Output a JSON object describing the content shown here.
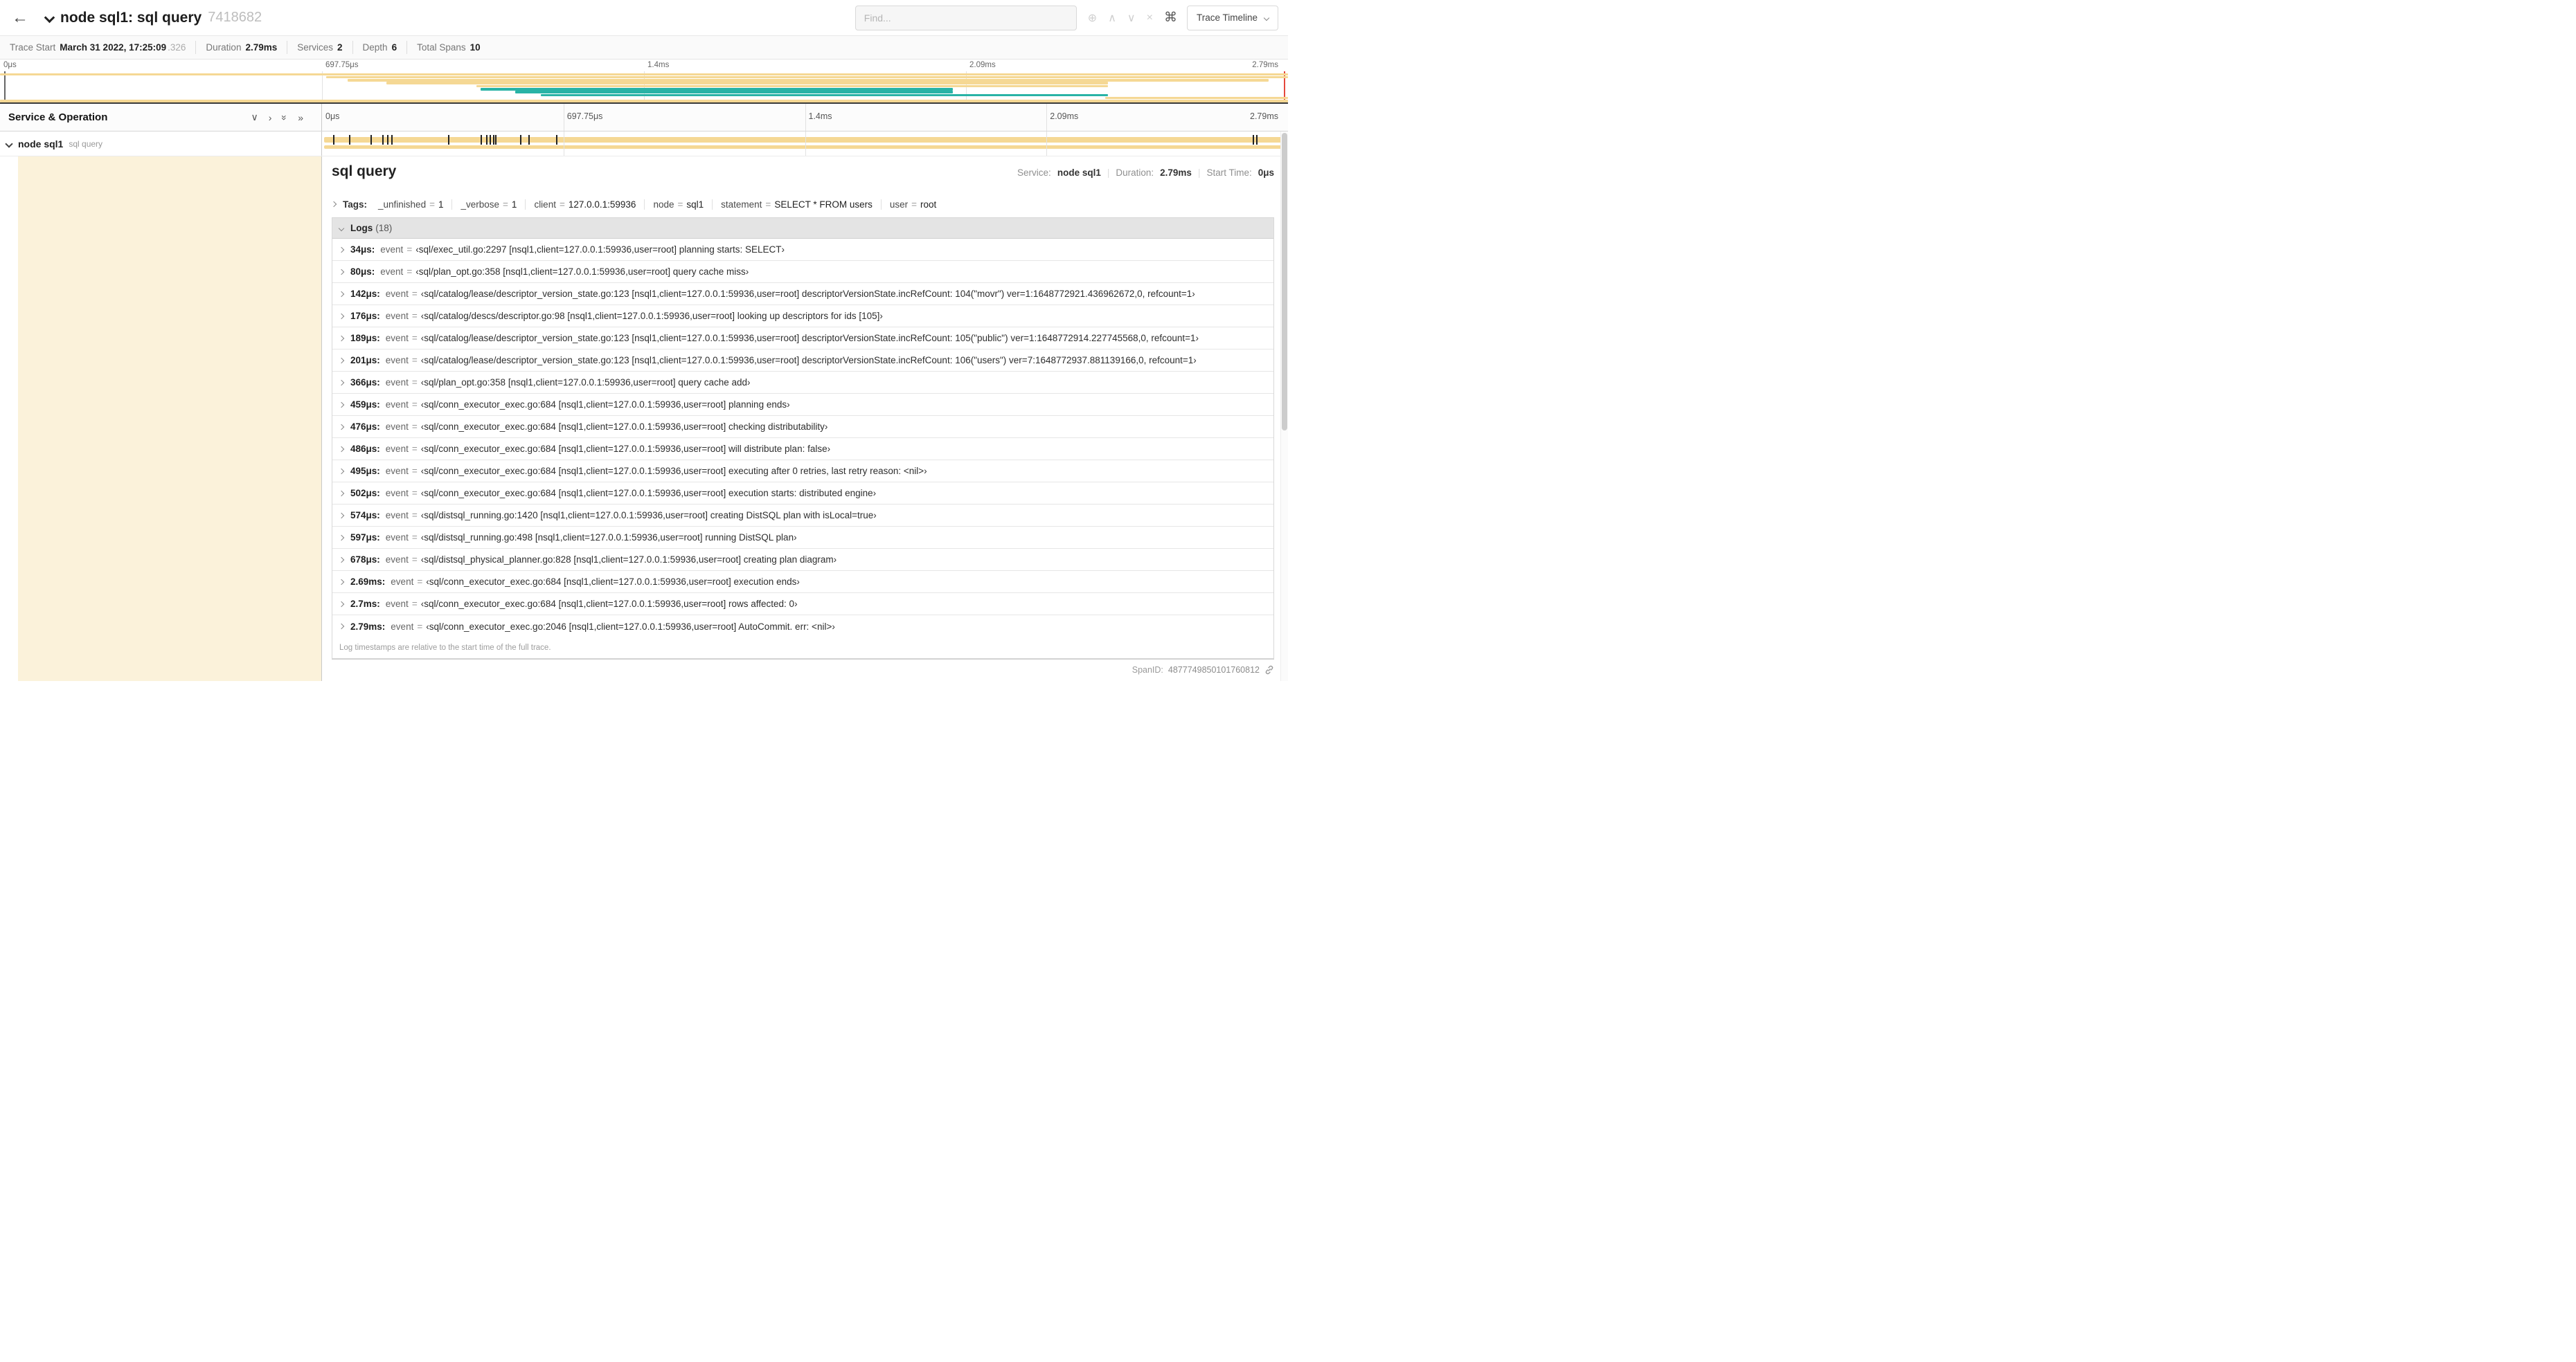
{
  "colors": {
    "tan": "#F5D894",
    "teal": "#29B3A6",
    "cream": "#FBF2DA"
  },
  "header": {
    "back_icon": "←",
    "title": "node sql1: sql query",
    "trace_id": "7418682",
    "find_placeholder": "Find...",
    "find_icons": {
      "zoom": "⊕",
      "prev": "∧",
      "next": "∨",
      "clear": "×"
    },
    "shortcut_icon": "⌘",
    "view_selector": "Trace Timeline"
  },
  "stats": [
    {
      "label": "Trace Start",
      "value": "March 31 2022, 17:25:09",
      "suffix": ".326"
    },
    {
      "label": "Duration",
      "value": "2.79ms",
      "suffix": ""
    },
    {
      "label": "Services",
      "value": "2",
      "suffix": ""
    },
    {
      "label": "Depth",
      "value": "6",
      "suffix": ""
    },
    {
      "label": "Total Spans",
      "value": "10",
      "suffix": ""
    }
  ],
  "timeline": {
    "duration_us": 2790,
    "ticks": [
      "0μs",
      "697.75μs",
      "1.4ms",
      "2.09ms",
      "2.79ms"
    ],
    "left_header": "Service & Operation",
    "icons": {
      "collapse_one": "∨",
      "expand_one": "›",
      "collapse_all": "»",
      "expand_all": "»"
    },
    "row": {
      "service": "node sql1",
      "operation": "sql query"
    }
  },
  "minimap": {
    "spans": [
      {
        "row": 0,
        "start": 0.0,
        "end": 1.0,
        "color": "tan"
      },
      {
        "row": 1,
        "start": 0.253,
        "end": 1.0,
        "color": "tan"
      },
      {
        "row": 2,
        "start": 0.27,
        "end": 0.985,
        "color": "tan"
      },
      {
        "row": 3,
        "start": 0.3,
        "end": 0.86,
        "color": "tan"
      },
      {
        "row": 4,
        "start": 0.37,
        "end": 0.86,
        "color": "tan"
      },
      {
        "row": 5,
        "start": 0.373,
        "end": 0.74,
        "color": "teal"
      },
      {
        "row": 6,
        "start": 0.4,
        "end": 0.74,
        "color": "teal"
      },
      {
        "row": 7,
        "start": 0.42,
        "end": 0.86,
        "color": "teal"
      },
      {
        "row": 8,
        "start": 0.858,
        "end": 1.0,
        "color": "tan"
      },
      {
        "row": 9,
        "start": 0.0,
        "end": 1.0,
        "color": "tan"
      }
    ]
  },
  "detail": {
    "title": "sql query",
    "service_label": "Service:",
    "service": "node sql1",
    "duration_label": "Duration:",
    "duration": "2.79ms",
    "start_label": "Start Time:",
    "start": "0μs",
    "tags_label": "Tags:",
    "tags": [
      {
        "key": "_unfinished",
        "value": "1"
      },
      {
        "key": "_verbose",
        "value": "1"
      },
      {
        "key": "client",
        "value": "127.0.0.1:59936"
      },
      {
        "key": "node",
        "value": "sql1"
      },
      {
        "key": "statement",
        "value": "SELECT * FROM users"
      },
      {
        "key": "user",
        "value": "root"
      }
    ],
    "logs_label": "Logs",
    "logs_count": "(18)",
    "logs": [
      {
        "time": "34μs:",
        "t_us": 34,
        "key": "event",
        "value": "‹sql/exec_util.go:2297 [nsql1,client=127.0.0.1:59936,user=root] planning starts: SELECT›"
      },
      {
        "time": "80μs:",
        "t_us": 80,
        "key": "event",
        "value": "‹sql/plan_opt.go:358 [nsql1,client=127.0.0.1:59936,user=root] query cache miss›"
      },
      {
        "time": "142μs:",
        "t_us": 142,
        "key": "event",
        "value": "‹sql/catalog/lease/descriptor_version_state.go:123 [nsql1,client=127.0.0.1:59936,user=root] descriptorVersionState.incRefCount: 104(\"movr\") ver=1:1648772921.436962672,0, refcount=1›"
      },
      {
        "time": "176μs:",
        "t_us": 176,
        "key": "event",
        "value": "‹sql/catalog/descs/descriptor.go:98 [nsql1,client=127.0.0.1:59936,user=root] looking up descriptors for ids [105]›"
      },
      {
        "time": "189μs:",
        "t_us": 189,
        "key": "event",
        "value": "‹sql/catalog/lease/descriptor_version_state.go:123 [nsql1,client=127.0.0.1:59936,user=root] descriptorVersionState.incRefCount: 105(\"public\") ver=1:1648772914.227745568,0, refcount=1›"
      },
      {
        "time": "201μs:",
        "t_us": 201,
        "key": "event",
        "value": "‹sql/catalog/lease/descriptor_version_state.go:123 [nsql1,client=127.0.0.1:59936,user=root] descriptorVersionState.incRefCount: 106(\"users\") ver=7:1648772937.881139166,0, refcount=1›"
      },
      {
        "time": "366μs:",
        "t_us": 366,
        "key": "event",
        "value": "‹sql/plan_opt.go:358 [nsql1,client=127.0.0.1:59936,user=root] query cache add›"
      },
      {
        "time": "459μs:",
        "t_us": 459,
        "key": "event",
        "value": "‹sql/conn_executor_exec.go:684 [nsql1,client=127.0.0.1:59936,user=root] planning ends›"
      },
      {
        "time": "476μs:",
        "t_us": 476,
        "key": "event",
        "value": "‹sql/conn_executor_exec.go:684 [nsql1,client=127.0.0.1:59936,user=root] checking distributability›"
      },
      {
        "time": "486μs:",
        "t_us": 486,
        "key": "event",
        "value": "‹sql/conn_executor_exec.go:684 [nsql1,client=127.0.0.1:59936,user=root] will distribute plan: false›"
      },
      {
        "time": "495μs:",
        "t_us": 495,
        "key": "event",
        "value": "‹sql/conn_executor_exec.go:684 [nsql1,client=127.0.0.1:59936,user=root] executing after 0 retries, last retry reason: <nil>›"
      },
      {
        "time": "502μs:",
        "t_us": 502,
        "key": "event",
        "value": "‹sql/conn_executor_exec.go:684 [nsql1,client=127.0.0.1:59936,user=root] execution starts: distributed engine›"
      },
      {
        "time": "574μs:",
        "t_us": 574,
        "key": "event",
        "value": "‹sql/distsql_running.go:1420 [nsql1,client=127.0.0.1:59936,user=root] creating DistSQL plan with isLocal=true›"
      },
      {
        "time": "597μs:",
        "t_us": 597,
        "key": "event",
        "value": "‹sql/distsql_running.go:498 [nsql1,client=127.0.0.1:59936,user=root] running DistSQL plan›"
      },
      {
        "time": "678μs:",
        "t_us": 678,
        "key": "event",
        "value": "‹sql/distsql_physical_planner.go:828 [nsql1,client=127.0.0.1:59936,user=root] creating plan diagram›"
      },
      {
        "time": "2.69ms:",
        "t_us": 2690,
        "key": "event",
        "value": "‹sql/conn_executor_exec.go:684 [nsql1,client=127.0.0.1:59936,user=root] execution ends›"
      },
      {
        "time": "2.7ms:",
        "t_us": 2700,
        "key": "event",
        "value": "‹sql/conn_executor_exec.go:684 [nsql1,client=127.0.0.1:59936,user=root] rows affected: 0›"
      },
      {
        "time": "2.79ms:",
        "t_us": 2790,
        "key": "event",
        "value": "‹sql/conn_executor_exec.go:2046 [nsql1,client=127.0.0.1:59936,user=root] AutoCommit. err: <nil>›"
      }
    ],
    "logs_note": "Log timestamps are relative to the start time of the full trace.",
    "span_id_label": "SpanID:",
    "span_id": "4877749850101760812"
  }
}
